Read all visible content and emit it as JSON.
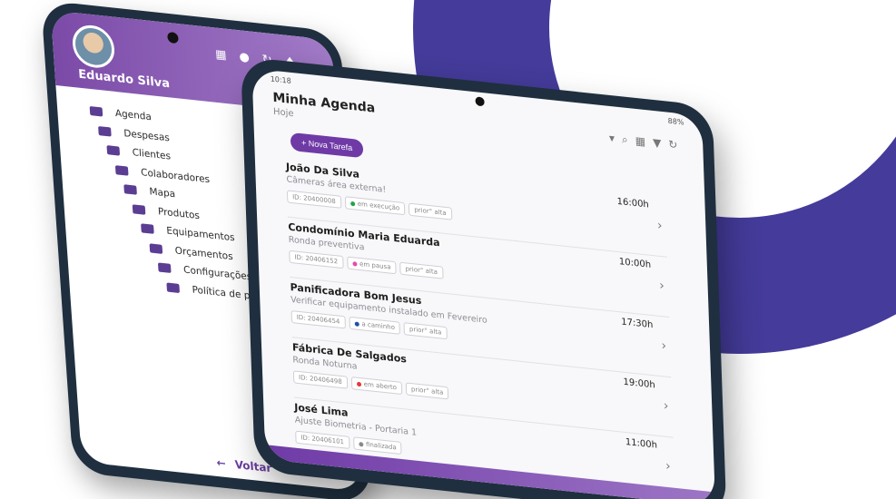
{
  "colors": {
    "accent": "#6f3aa6",
    "arc": "#443b9a",
    "frame": "#1f2f3f"
  },
  "menu_phone": {
    "user_name": "Eduardo Silva",
    "header_icons": [
      "qr-code-icon",
      "chat-icon",
      "sync-icon",
      "bell-icon"
    ],
    "items": [
      {
        "label": "Agenda",
        "icon": "calendar-icon"
      },
      {
        "label": "Despesas",
        "icon": "money-icon"
      },
      {
        "label": "Clientes",
        "icon": "handshake-icon"
      },
      {
        "label": "Colaboradores",
        "icon": "users-icon"
      },
      {
        "label": "Mapa",
        "icon": "map-icon"
      },
      {
        "label": "Produtos",
        "icon": "boxes-icon"
      },
      {
        "label": "Equipamentos",
        "icon": "tools-icon"
      },
      {
        "label": "Orçamentos",
        "icon": "file-icon"
      },
      {
        "label": "Configurações",
        "icon": "gear-icon"
      },
      {
        "label": "Política de privacidade",
        "icon": "lock-icon"
      }
    ],
    "back_label": "Voltar"
  },
  "agenda_phone": {
    "status_time": "10:18",
    "status_battery": "88%",
    "title": "Minha Agenda",
    "subtitle": "Hoje",
    "new_task_label": "+ Nova Tarefa",
    "tasks": [
      {
        "title": "João Da Silva",
        "time": "16:00h",
        "desc": "Câmeras área externa!",
        "id": "ID: 20400008",
        "status": "em execução",
        "status_color": "#22a447",
        "priority": "prior° alta"
      },
      {
        "title": "Condomínio Maria Eduarda",
        "time": "10:00h",
        "desc": "Ronda  preventiva",
        "id": "ID: 20406152",
        "status": "em pausa",
        "status_color": "#e04fa8",
        "priority": "prior° alta"
      },
      {
        "title": "Panificadora Bom Jesus",
        "time": "17:30h",
        "desc": "Verificar equipamento instalado em Fevereiro",
        "id": "ID: 20406454",
        "status": "a caminho",
        "status_color": "#1f4fa8",
        "priority": "prior° alta"
      },
      {
        "title": "Fábrica De Salgados",
        "time": "19:00h",
        "desc": "Ronda Noturna",
        "id": "ID: 20406498",
        "status": "em aberto",
        "status_color": "#e53935",
        "priority": "prior° alta"
      },
      {
        "title": "José Lima",
        "time": "11:00h",
        "desc": "Ajuste Biometria - Portaria 1",
        "id": "ID: 20406101",
        "status": "finalizada",
        "status_color": "#8a8a8a",
        "priority": ""
      }
    ]
  }
}
